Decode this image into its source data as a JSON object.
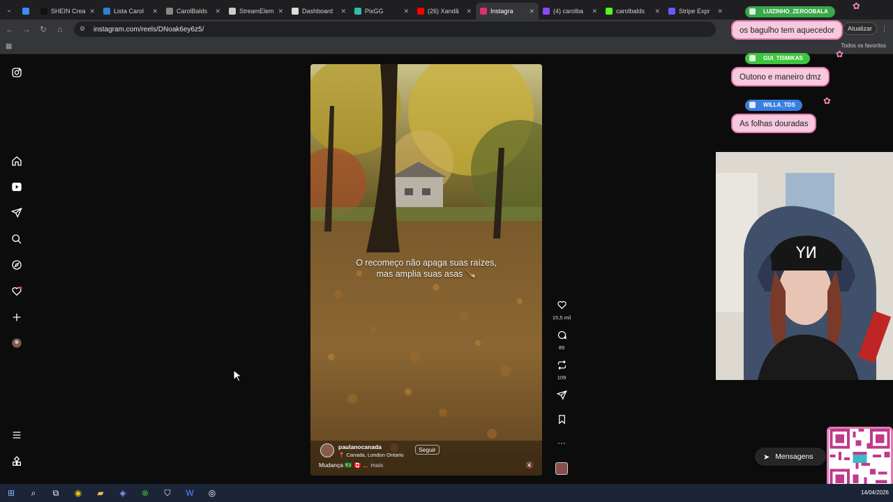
{
  "browser": {
    "tabs": [
      {
        "label": "",
        "color": "#3d8bff"
      },
      {
        "label": "SHEIN Crea",
        "color": "#111111"
      },
      {
        "label": "Lista Carol",
        "color": "#2f7fd6"
      },
      {
        "label": "CarolBalds",
        "color": "#888888"
      },
      {
        "label": "StreamElem",
        "color": "#cccccc"
      },
      {
        "label": "Dashboard",
        "color": "#dddddd"
      },
      {
        "label": "PixGG",
        "color": "#32bcad"
      },
      {
        "label": "(26) Xandã",
        "color": "#ff0000"
      },
      {
        "label": "Instagra",
        "color": "#e1306c",
        "active": true
      },
      {
        "label": "(4) carolba",
        "color": "#9146ff"
      },
      {
        "label": "carolbalds",
        "color": "#53fc18"
      },
      {
        "label": "Stripe Expr",
        "color": "#635bff"
      }
    ],
    "url": "instagram.com/reels/DNoak6ey6z5/",
    "update_label": "Atualizar",
    "all_bookmarks": "Todos os favoritos"
  },
  "reel": {
    "caption_line1": "O recomeço não apaga suas raízes,",
    "caption_line2": "mas amplia suas asas 🪶",
    "author": "paulanocanada",
    "location": "Canada, London Ontario",
    "follow_label": "Seguir",
    "description": "Mudança 🇧🇷 🇨🇦 ...",
    "more_label": "mais",
    "likes": "15,5 mil",
    "comments": "89",
    "reposts": "109"
  },
  "chat": [
    {
      "user": "LUIZINHO_ZEROOBALA",
      "message": "os bagulho tem aquecedor",
      "user_color": "#3aa84a"
    },
    {
      "user": "GUI_TISMIKAS",
      "message": "Outono e maneiro dmz",
      "user_color": "#3ec43e"
    },
    {
      "user": "WILLA_TDS",
      "message": "As folhas douradas",
      "user_color": "#3a7fe0"
    }
  ],
  "messages_label": "Mensagens",
  "taskbar": {
    "date": "14/04/2026"
  }
}
